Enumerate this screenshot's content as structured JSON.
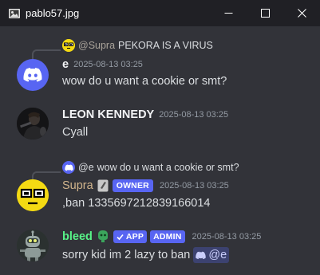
{
  "window": {
    "title": "pablo57.jpg",
    "controls": [
      "minimize",
      "maximize",
      "close"
    ]
  },
  "messages": [
    {
      "reply": {
        "name": "@Supra",
        "text": "PEKORA IS A VIRUS",
        "avatar_icon": "supra-face-icon"
      },
      "author": "e",
      "author_color": "#f2f3f5",
      "timestamp": "2025-08-13 03:25",
      "text": "wow do u want a cookie or smt?",
      "avatar_icon": "discord-logo-icon"
    },
    {
      "author": "LEON KENNEDY",
      "author_color": "#f2f3f5",
      "timestamp": "2025-08-13 03:25",
      "text": "Cyall",
      "avatar_icon": "leon-photo-avatar"
    },
    {
      "reply": {
        "name": "@e",
        "text": "wow do u want a cookie or smt?",
        "avatar_icon": "discord-logo-icon"
      },
      "author": "Supra",
      "author_color": "#d1b48c",
      "badge": "OWNER",
      "timestamp": "2025-08-13 03:25",
      "text": ",ban 1335697212839166014",
      "avatar_icon": "supra-face-icon"
    },
    {
      "author": "bleed",
      "author_color": "#57f287",
      "app_badge": "APP",
      "badge": "ADMIN",
      "timestamp": "2025-08-13 03:25",
      "text": "sorry kid im 2 lazy to ban",
      "mention": "@e",
      "avatar_icon": "robot-avatar"
    }
  ],
  "colors": {
    "background": "#323339",
    "titlebar": "#202025",
    "blurple": "#5865f2",
    "timestamp": "#949ba4"
  }
}
